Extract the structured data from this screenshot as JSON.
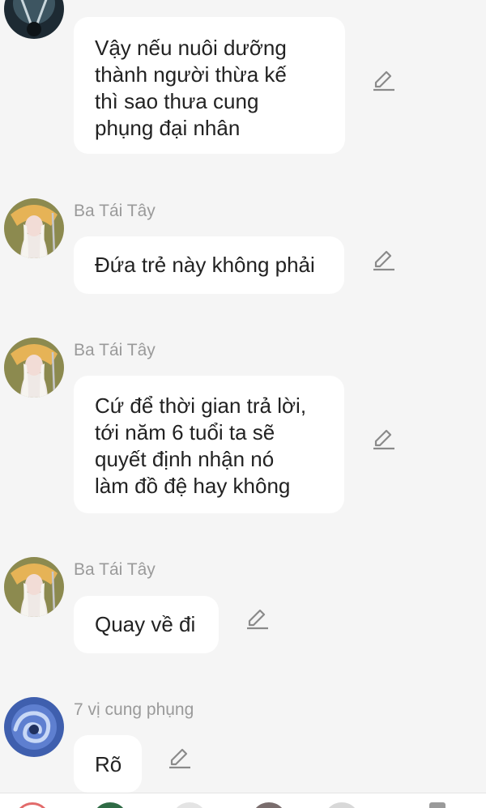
{
  "messages": [
    {
      "sender": "",
      "text": "Vậy nếu nuôi dưỡng\nthành người thừa kế\nthì sao thưa cung\nphụng đại nhân",
      "avatar_icon": "dark-figure-avatar"
    },
    {
      "sender": "Ba Tái Tây",
      "text": "Đứa trẻ này không phải",
      "avatar_icon": "ba-tai-tay-avatar"
    },
    {
      "sender": "Ba Tái Tây",
      "text": "Cứ để thời gian trả lời,\ntới năm 6 tuổi ta sẽ\nquyết định nhận nó\nlàm đồ đệ hay không",
      "avatar_icon": "ba-tai-tay-avatar"
    },
    {
      "sender": "Ba Tái Tây",
      "text": "Quay về đi",
      "avatar_icon": "ba-tai-tay-avatar"
    },
    {
      "sender": "7 vị cung phụng",
      "text": "Rõ",
      "avatar_icon": "blue-swirl-avatar"
    }
  ],
  "edit_icon": "pencil-icon",
  "colors": {
    "background": "#f5f5f5",
    "bubble": "#ffffff",
    "sender_text": "#9a9a9a",
    "message_text": "#222222",
    "icon": "#8a8a8a"
  }
}
